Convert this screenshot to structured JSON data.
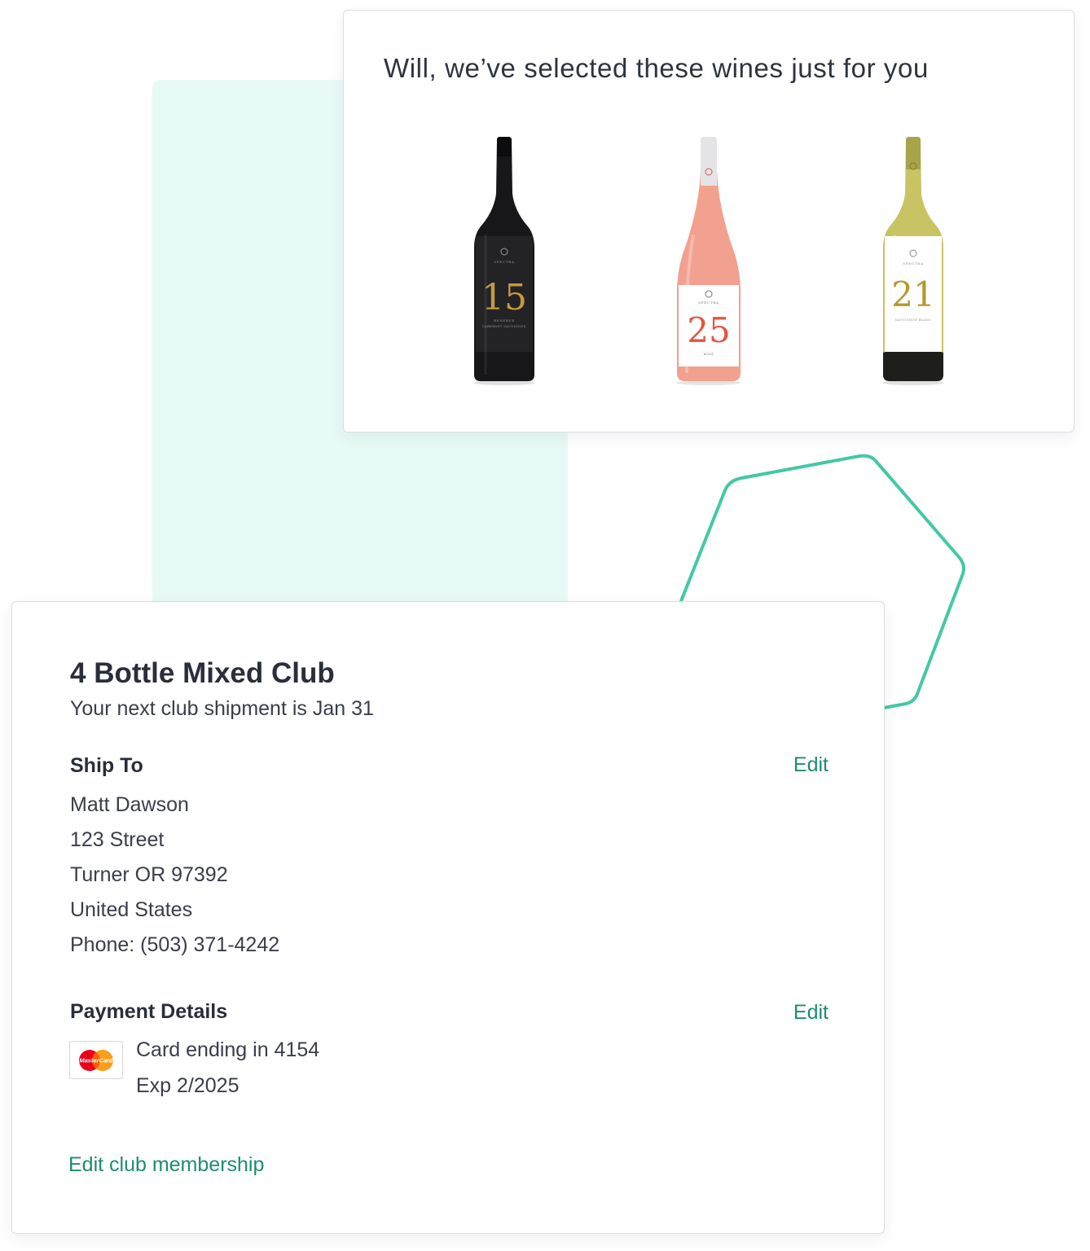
{
  "recommendation": {
    "heading": "Will, we’ve selected these wines just for you",
    "wines": [
      {
        "brand": "SPECTRA",
        "number": "15",
        "tier": "RESERVE",
        "varietal": "CABERNET SAUVIGNON",
        "bottle_color": "#17171a",
        "label_color": "#232326",
        "number_color": "#c59a3e"
      },
      {
        "brand": "SPECTRA",
        "number": "25",
        "varietal": "ROSÉ",
        "bottle_color": "#f2a08f",
        "label_color": "#ffffff",
        "number_color": "#e2553f"
      },
      {
        "brand": "SPECTRA",
        "number": "21",
        "varietal": "SAUVIGNON BLANC",
        "bottle_color": "#c9c463",
        "label_color": "#ffffff",
        "number_color": "#b8962d"
      }
    ]
  },
  "club": {
    "title": "4 Bottle Mixed Club",
    "next_shipment": "Your next club shipment is Jan 31",
    "ship_to": {
      "heading": "Ship To",
      "edit_label": "Edit",
      "name": "Matt Dawson",
      "street": "123 Street",
      "city_line": "Turner OR 97392",
      "country": "United States",
      "phone": "Phone: (503) 371-4242"
    },
    "payment": {
      "heading": "Payment Details",
      "edit_label": "Edit",
      "card_brand": "MasterCard",
      "card_line": "Card ending in 4154",
      "exp_line": "Exp 2/2025"
    },
    "edit_membership_label": "Edit club membership"
  },
  "colors": {
    "accent": "#1d8c72",
    "mint_background": "#e8faf5",
    "hexagon_stroke": "#43c8a6",
    "text": "#2f3340"
  }
}
